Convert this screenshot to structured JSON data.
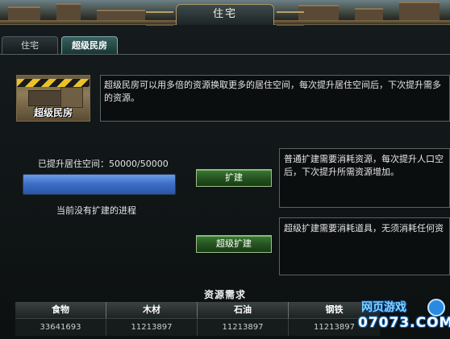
{
  "window": {
    "title": "住宅"
  },
  "tabs": [
    {
      "label": "住宅",
      "active": false
    },
    {
      "label": "超级民房",
      "active": true
    }
  ],
  "intro": {
    "image_caption": "超级民房",
    "text": "超级民房可以用多倍的资源换取更多的居住空间，每次提升居住空间后，下次提升需多的资源。"
  },
  "living_space": {
    "label": "已提升居住空间：50000/50000",
    "current": 50000,
    "max": 50000,
    "progress": 1.0,
    "status": "当前没有扩建的进程"
  },
  "actions": {
    "expand_label": "扩建",
    "expand_desc": "普通扩建需要消耗资源，每次提升人口空后，下次提升所需资源增加。",
    "super_expand_label": "超级扩建",
    "super_expand_desc": "超级扩建需要消耗道具，无须消耗任何资"
  },
  "resources": {
    "title": "资源需求",
    "headers": [
      "食物",
      "木材",
      "石油",
      "钢铁"
    ],
    "values": [
      "33641693",
      "11213897",
      "11213897",
      "11213897"
    ]
  },
  "watermark": {
    "line1": "网页游戏",
    "line2": "07073.COM"
  },
  "colors": {
    "progress_fill": "#3c6cc3",
    "button_green": "#24521f",
    "active_tab": "#386260"
  }
}
